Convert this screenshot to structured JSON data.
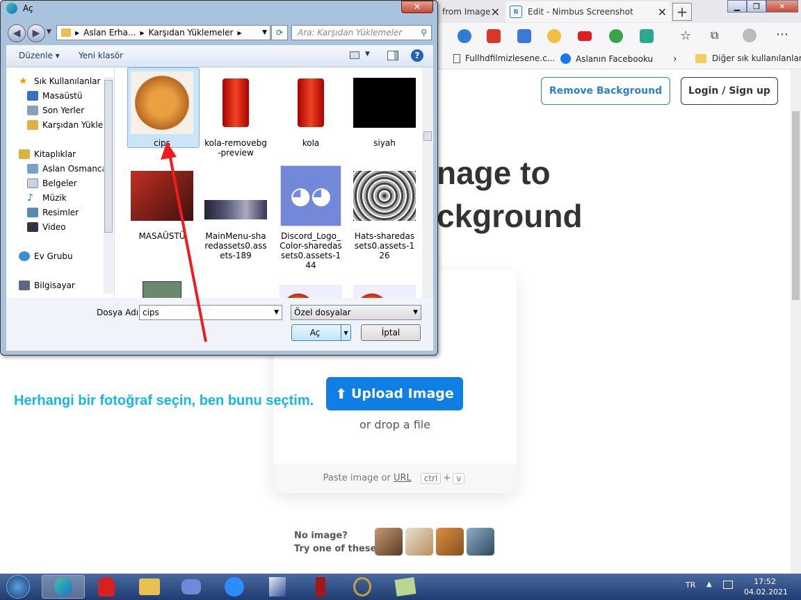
{
  "browser": {
    "tabs": [
      {
        "label": "from Image"
      },
      {
        "label": "Edit - Nimbus Screenshot"
      }
    ],
    "favorites": [
      {
        "label": "Fullhdfilmizlesene.c..."
      },
      {
        "label": "Aslanın Facebooku"
      },
      {
        "label": "Diğer sık kullanılanlar"
      }
    ]
  },
  "page": {
    "remove_bg_button": "Remove Background",
    "login_button": "Login / Sign up",
    "hero_line1": "nage to",
    "hero_line2": "ckground",
    "upload_button": "Upload Image",
    "drop_text": "or drop a file",
    "paste_text": "Paste image or",
    "paste_link": "URL",
    "kbd_ctrl": "ctrl",
    "kbd_plus": "+",
    "kbd_v": "v",
    "no_image": "No image?",
    "try_one": "Try one of these:"
  },
  "annotation": {
    "text": "Herhangi bir fotoğraf seçin, ben bunu seçtim."
  },
  "dialog": {
    "title": "Aç",
    "close": "✕",
    "breadcrumb": [
      "Aslan Erha...",
      "Karşıdan Yüklemeler"
    ],
    "search_placeholder": "Ara: Karşıdan Yüklemeler",
    "organize": "Düzenle",
    "new_folder": "Yeni klasör",
    "nav": [
      {
        "label": "Sık Kullanılanlar",
        "icon": "star-icon"
      },
      {
        "label": "Masaüstü",
        "icon": "desktop-icon"
      },
      {
        "label": "Son Yerler",
        "icon": "recent-places-icon"
      },
      {
        "label": "Karşıdan Yüklem",
        "icon": "downloads-icon"
      },
      {
        "label": "Kitaplıklar",
        "icon": "libraries-icon"
      },
      {
        "label": "Aslan Osmancan",
        "icon": "user-folder-icon"
      },
      {
        "label": "Belgeler",
        "icon": "documents-icon"
      },
      {
        "label": "Müzik",
        "icon": "music-icon"
      },
      {
        "label": "Resimler",
        "icon": "pictures-icon"
      },
      {
        "label": "Video",
        "icon": "video-icon"
      },
      {
        "label": "Ev Grubu",
        "icon": "homegroup-icon"
      },
      {
        "label": "Bilgisayar",
        "icon": "computer-icon"
      }
    ],
    "files": [
      {
        "name": "cips",
        "selected": true
      },
      {
        "name": "kola-removebg-preview"
      },
      {
        "name": "kola"
      },
      {
        "name": "siyah"
      },
      {
        "name": "MASAÜSTÜ"
      },
      {
        "name": "MainMenu-sharedassets0.assets-189"
      },
      {
        "name": "Discord_Logo_Color-sharedassets0.assets-144"
      },
      {
        "name": "Hats-sharedassets0.assets-126"
      }
    ],
    "filename_label": "Dosya Adı:",
    "filename_value": "cips",
    "filetype_value": "Özel dosyalar",
    "open_button": "Aç",
    "cancel_button": "İptal"
  },
  "taskbar": {
    "language": "TR",
    "time": "17:52",
    "date": "04.02.2021"
  },
  "colors": {
    "accent": "#0f7fe6",
    "annotation": "#14b8e8",
    "arrow": "#ee1c1c"
  }
}
